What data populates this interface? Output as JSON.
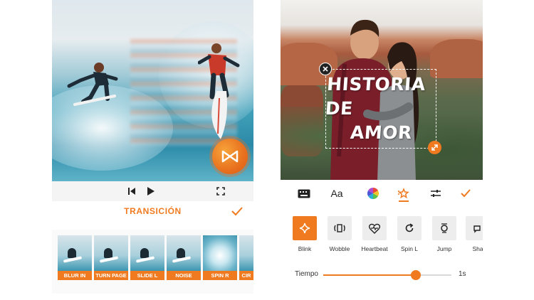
{
  "left_screen": {
    "player": {
      "skip_back_icon": "skip-previous-icon",
      "play_icon": "play-icon",
      "fullscreen_icon": "fullscreen-icon"
    },
    "transition_button_icon": "transition-bowtie-icon",
    "section_title": "TRANSICIÓN",
    "confirm_icon": "check-icon",
    "transitions": [
      {
        "label": "BLUR IN"
      },
      {
        "label": "TURN PAGE"
      },
      {
        "label": "SLIDE L"
      },
      {
        "label": "NOISE"
      },
      {
        "label": "SPIN R"
      },
      {
        "label": "CIR"
      }
    ]
  },
  "right_screen": {
    "overlay_text": {
      "line1": "HISTORIA DE",
      "line2": "AMOR"
    },
    "toolbar": [
      {
        "name": "keyboard-icon"
      },
      {
        "name": "font",
        "label": "Aa"
      },
      {
        "name": "color-wheel-icon"
      },
      {
        "name": "animation-icon",
        "active": true
      },
      {
        "name": "adjust-icon"
      },
      {
        "name": "check-icon"
      }
    ],
    "effects": [
      {
        "label": "Blink",
        "icon": "sparkle-icon",
        "active": true
      },
      {
        "label": "Wobble",
        "icon": "wobble-icon"
      },
      {
        "label": "Heartbeat",
        "icon": "heartbeat-icon"
      },
      {
        "label": "Spin L",
        "icon": "rotate-icon"
      },
      {
        "label": "Jump",
        "icon": "jump-icon"
      },
      {
        "label": "Sha",
        "icon": "shake-icon"
      }
    ],
    "slider": {
      "label": "Tiempo",
      "value_text": "1s",
      "position": 0.72
    },
    "accent_color": "#ef7a1f"
  }
}
